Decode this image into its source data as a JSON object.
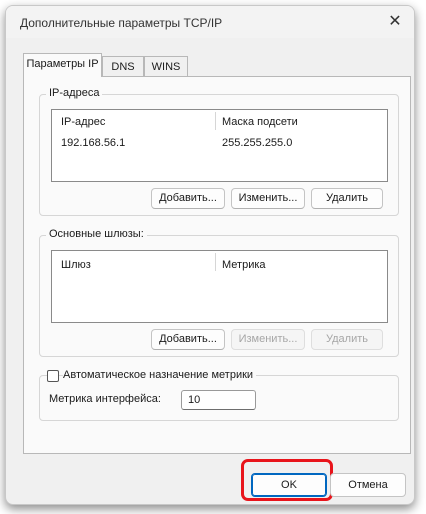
{
  "window": {
    "title": "Дополнительные параметры TCP/IP",
    "close_icon": "✕"
  },
  "tabs": [
    {
      "label": "Параметры IP",
      "active": true
    },
    {
      "label": "DNS",
      "active": false
    },
    {
      "label": "WINS",
      "active": false
    }
  ],
  "ip_group": {
    "legend": "IP-адреса",
    "columns": [
      "IP-адрес",
      "Маска подсети"
    ],
    "rows": [
      [
        "192.168.56.1",
        "255.255.255.0"
      ]
    ],
    "buttons": {
      "add": "Добавить...",
      "edit": "Изменить...",
      "delete": "Удалить"
    }
  },
  "gateway_group": {
    "legend": "Основные шлюзы:",
    "columns": [
      "Шлюз",
      "Метрика"
    ],
    "rows": [],
    "buttons": {
      "add": "Добавить...",
      "edit": "Изменить...",
      "delete": "Удалить"
    }
  },
  "metric_group": {
    "auto_metric_label": "Автоматическое назначение метрики",
    "auto_metric_checked": false,
    "interface_metric_label": "Метрика интерфейса:",
    "interface_metric_value": "10"
  },
  "footer": {
    "ok_label": "OK",
    "cancel_label": "Отмена"
  },
  "colors": {
    "highlight": "#e8141b",
    "accent": "#0067c0"
  }
}
